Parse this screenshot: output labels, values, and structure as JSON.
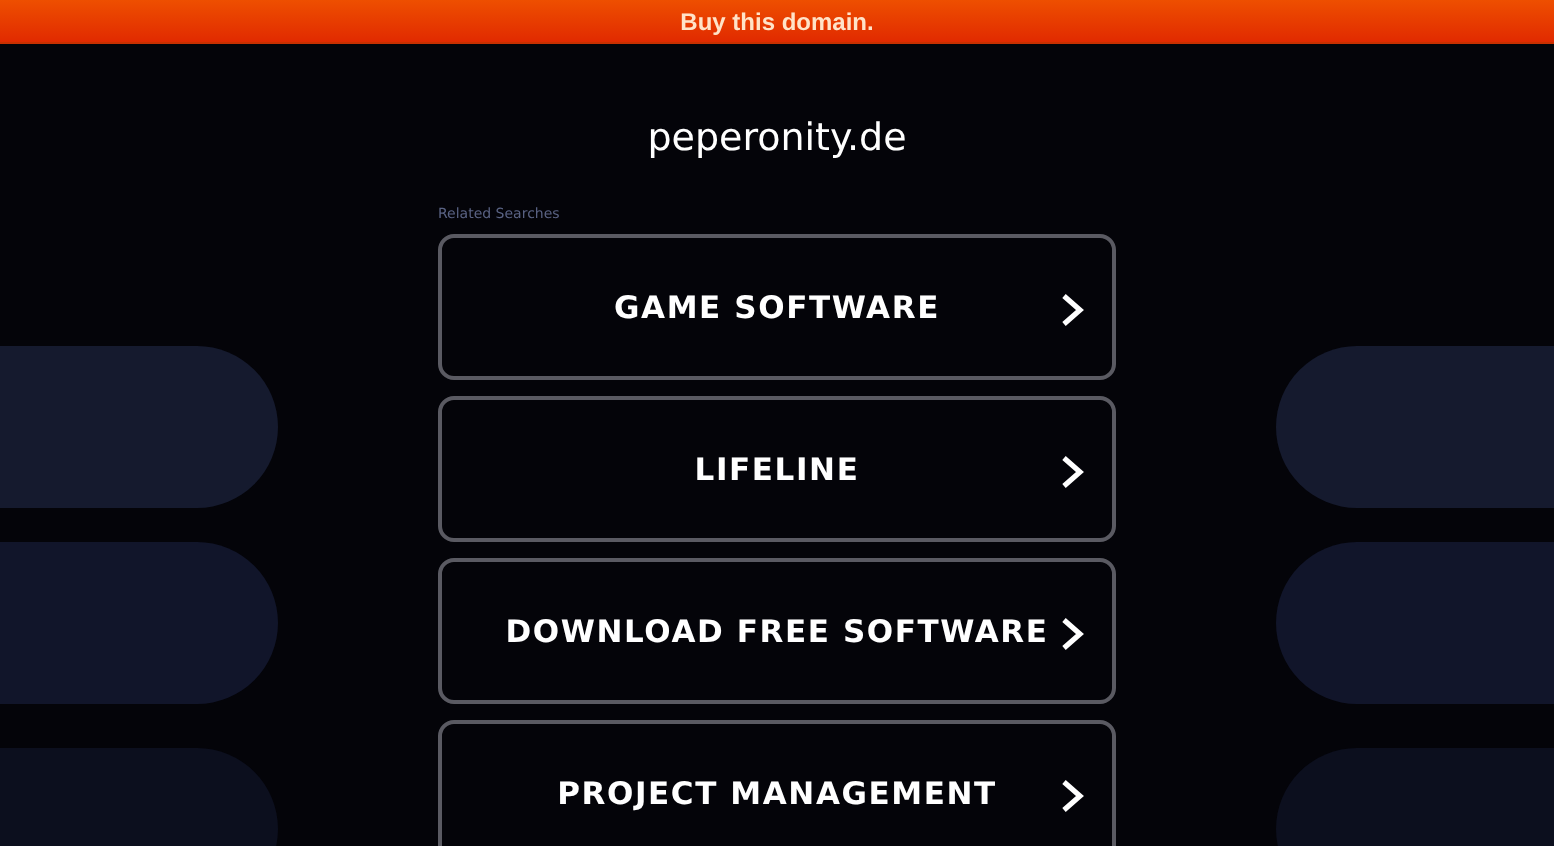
{
  "banner": {
    "label": "Buy this domain."
  },
  "domain": "peperonity.de",
  "related_label": "Related Searches",
  "links": [
    {
      "label": "GAME SOFTWARE"
    },
    {
      "label": "LIFELINE"
    },
    {
      "label": "DOWNLOAD FREE SOFTWARE"
    },
    {
      "label": "PROJECT MANAGEMENT"
    }
  ]
}
